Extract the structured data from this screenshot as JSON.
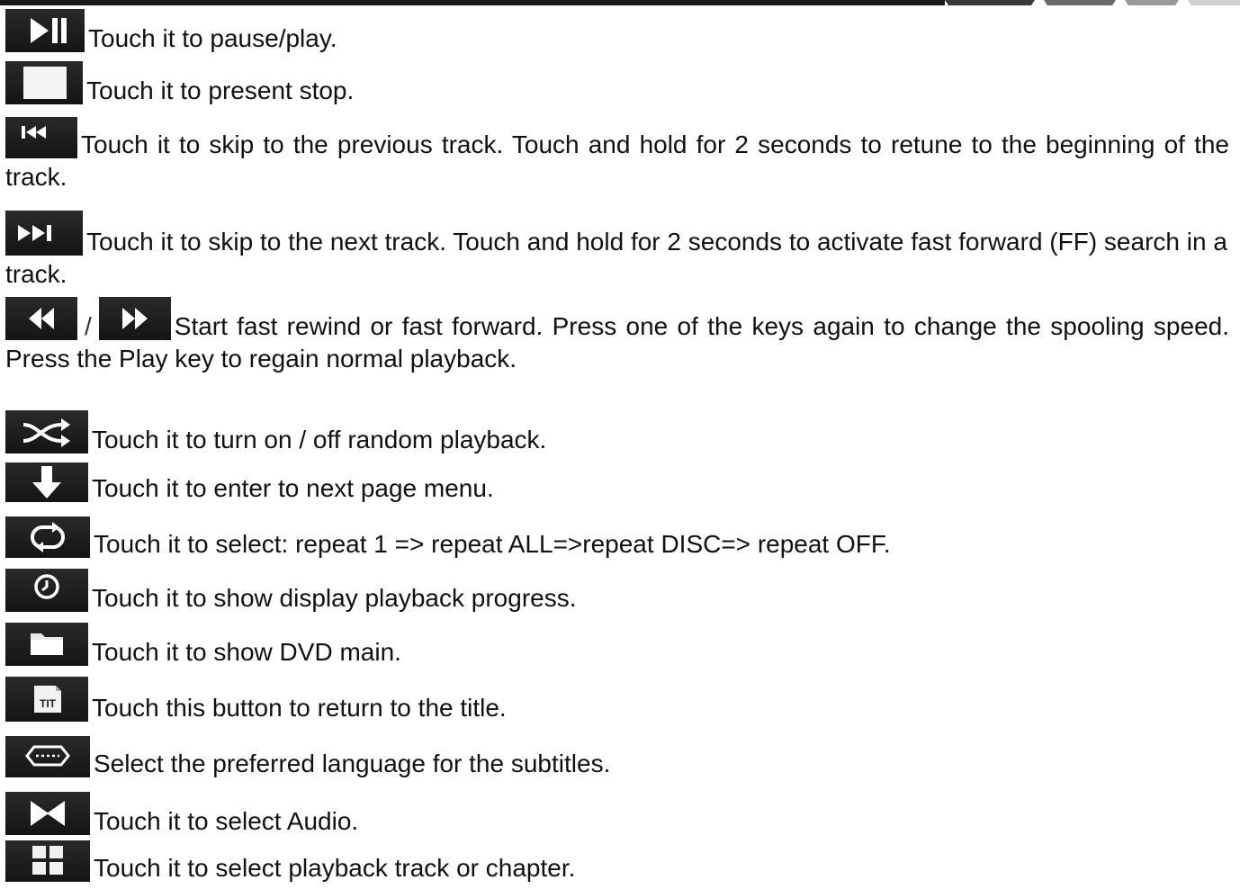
{
  "items": [
    {
      "icon": "play-pause-icon",
      "text": "Touch it to pause/play."
    },
    {
      "icon": "stop-icon",
      "text": "Touch it to present stop."
    },
    {
      "icon": "previous-track-icon",
      "text": "Touch it to skip to the previous track. Touch and hold for 2 seconds to retune to the beginning of the track."
    },
    {
      "icon": "next-track-icon",
      "text": "Touch it to skip to the next track. Touch and hold for 2 seconds to activate fast forward (FF) search in a track."
    },
    {
      "icon": "rewind-icon",
      "separator": "/",
      "icon2": "fast-forward-icon",
      "text": "Start fast rewind or fast forward. Press one of the keys again to change the spooling speed. Press the Play key to regain normal playback."
    },
    {
      "icon": "shuffle-icon",
      "text": "Touch it to turn on / off random playback."
    },
    {
      "icon": "down-arrow-icon",
      "text": "Touch it to enter to next page menu."
    },
    {
      "icon": "repeat-icon",
      "text": "Touch it to select: repeat 1 => repeat ALL=>repeat DISC=> repeat OFF."
    },
    {
      "icon": "clock-icon",
      "text": "Touch it to show display playback progress."
    },
    {
      "icon": "folder-icon",
      "text": "Touch it to show DVD main."
    },
    {
      "icon": "title-icon",
      "icon_label": "TIT",
      "text": "Touch this button to return to the title."
    },
    {
      "icon": "subtitle-icon",
      "text": "Select the preferred language for the subtitles."
    },
    {
      "icon": "audio-icon",
      "text": "Touch it to select Audio."
    },
    {
      "icon": "chapter-grid-icon",
      "text": "Touch it to select playback track or chapter."
    }
  ]
}
